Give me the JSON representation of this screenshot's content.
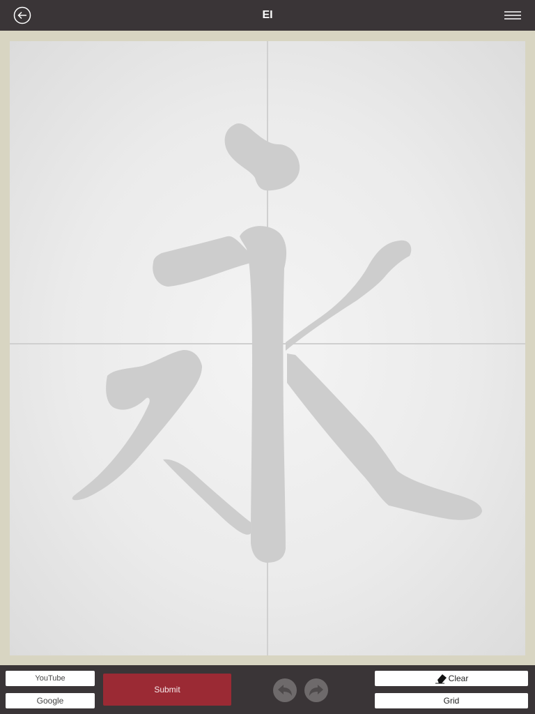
{
  "header": {
    "title": "EI",
    "back_icon": "back-arrow-icon",
    "menu_icon": "hamburger-menu-icon"
  },
  "canvas": {
    "guide_character": "永",
    "grid_visible": true,
    "colors": {
      "frame": "#d8d5c2",
      "guide_stroke": "#c8c8c8"
    }
  },
  "toolbar": {
    "youtube_label": "YouTube",
    "google_label": "Google",
    "submit_label": "Submit",
    "undo_icon": "undo-arrow-icon",
    "redo_icon": "redo-arrow-icon",
    "clear_label": "Clear",
    "clear_icon": "eraser-icon",
    "grid_label": "Grid"
  },
  "colors": {
    "bar": "#3a3537",
    "submit": "#9b2a34",
    "button": "#ffffff"
  }
}
